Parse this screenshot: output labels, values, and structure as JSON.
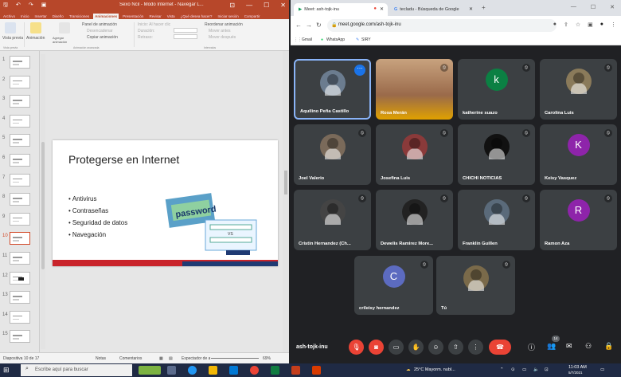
{
  "powerpoint": {
    "title_bar": "Sexo Ncil - Modo Internet - Navegar L...",
    "tabs": [
      "Archivo",
      "Inicio",
      "Insertar",
      "Diseño",
      "Transiciones",
      "Animaciones",
      "Presentación",
      "Revisar",
      "Vista",
      "¿Qué desea hacer?",
      "Iniciar sesión",
      "Compartir"
    ],
    "active_tab": "Animaciones",
    "ribbon": {
      "preview_label": "Vista previa",
      "animation_label": "Animación",
      "effect_options_label": "Agregar animación",
      "animation_pane": "Panel de animación",
      "trigger": "Desencadenar",
      "copy_animation": "Copiar animación",
      "start": "Inicio: Al hacer clic",
      "duration": "Duración:",
      "delay": "Retraso:",
      "reorder": "Reordenar animación",
      "move_earlier": "Mover antes",
      "move_later": "Mover después",
      "group_preview": "Vista previa",
      "group_advanced": "Animación avanzada",
      "group_timing": "Intervalos"
    },
    "thumbnails": [
      "1",
      "2",
      "3",
      "4",
      "5",
      "6",
      "7",
      "8",
      "9",
      "10",
      "11",
      "12",
      "13",
      "14",
      "15"
    ],
    "selected_slide": "10",
    "slide": {
      "title": "Protegerse en Internet",
      "bullets": [
        "Antivirus",
        "Contraseñas",
        "Seguridad de datos",
        "Navegación"
      ],
      "art_word": "password",
      "art_small": "VS"
    },
    "status_bar": {
      "slide_info": "Diapositiva 10 de 17",
      "notes": "Notas",
      "comments": "Comentarios",
      "view_label": "Espectador de animación",
      "zoom": "69%"
    }
  },
  "chrome": {
    "tabs": [
      {
        "label": "Meet: ash-tojk-inu"
      },
      {
        "label": "tecladu - Búsqueda de Google"
      }
    ],
    "url": "meet.google.com/ash-tojk-inu",
    "bookmarks": [
      "Gmail",
      "WhatsApp",
      "SIRY"
    ],
    "participants": [
      {
        "name": "Aquilino Peña Castillo",
        "kind": "video",
        "color": "#6b7c8f",
        "active": true
      },
      {
        "name": "Rosa Merán",
        "kind": "full"
      },
      {
        "name": "katherine suazo",
        "kind": "avatar",
        "letter": "k",
        "color": "#0b8043"
      },
      {
        "name": "Carolina Luis",
        "kind": "video",
        "color": "#8a7a5a"
      },
      {
        "name": "Joel Valerio",
        "kind": "video",
        "color": "#7a6a5a"
      },
      {
        "name": "Josefina Luis",
        "kind": "video",
        "color": "#8a3a3a"
      },
      {
        "name": "CHICHI NOTICIAS",
        "kind": "video",
        "color": "#111111"
      },
      {
        "name": "Keisy Vasquez",
        "kind": "avatar",
        "letter": "K",
        "color": "#8e24aa"
      },
      {
        "name": "Cristin Hernandez (Ch...",
        "kind": "video",
        "color": "#444444"
      },
      {
        "name": "Dewelis Ramirez More...",
        "kind": "video",
        "color": "#222222"
      },
      {
        "name": "Franklin Guillen",
        "kind": "video",
        "color": "#5a6a7a"
      },
      {
        "name": "Ramon Aza",
        "kind": "avatar",
        "letter": "R",
        "color": "#8e24aa"
      },
      {
        "name": "crileisy hernandez",
        "kind": "avatar",
        "letter": "C",
        "color": "#5c6bc0"
      },
      {
        "name": "Tú",
        "kind": "video",
        "color": "#7a6a4a"
      }
    ],
    "meeting_code": "ash-tojk-inu",
    "participant_count": "14"
  },
  "taskbar": {
    "search_placeholder": "Escribe aquí para buscar",
    "weather": "25°C Mayorm. nubl...",
    "time": "11:03 AM",
    "date": "5/7/2021"
  }
}
